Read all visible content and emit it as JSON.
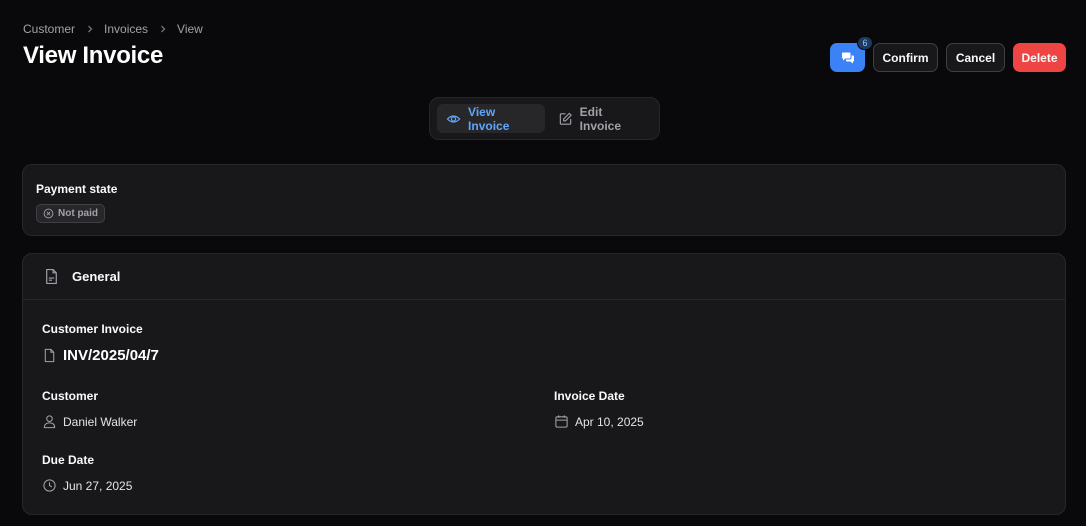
{
  "breadcrumb": [
    "Customer",
    "Invoices",
    "View"
  ],
  "page_title": "View Invoice",
  "actions": {
    "chat_badge": "6",
    "confirm": "Confirm",
    "cancel": "Cancel",
    "delete": "Delete"
  },
  "tabs": [
    {
      "label": "View Invoice",
      "icon": "eye-icon",
      "active": true
    },
    {
      "label": "Edit Invoice",
      "icon": "pencil-icon",
      "active": false
    }
  ],
  "payment": {
    "label": "Payment state",
    "status": "Not paid",
    "status_icon": "x-circle-icon"
  },
  "general": {
    "title": "General",
    "icon": "document-icon",
    "customer_invoice_label": "Customer Invoice",
    "invoice_number": "INV/2025/04/7",
    "customer_label": "Customer",
    "customer_value": "Daniel Walker",
    "invoice_date_label": "Invoice Date",
    "invoice_date_value": "Apr 10, 2025",
    "due_date_label": "Due Date",
    "due_date_value": "Jun 27, 2025"
  },
  "colors": {
    "background": "#09090b",
    "card": "#18181b",
    "accent": "#3b82f6",
    "danger": "#ef4444",
    "active_tab_text": "#60a5fa"
  }
}
